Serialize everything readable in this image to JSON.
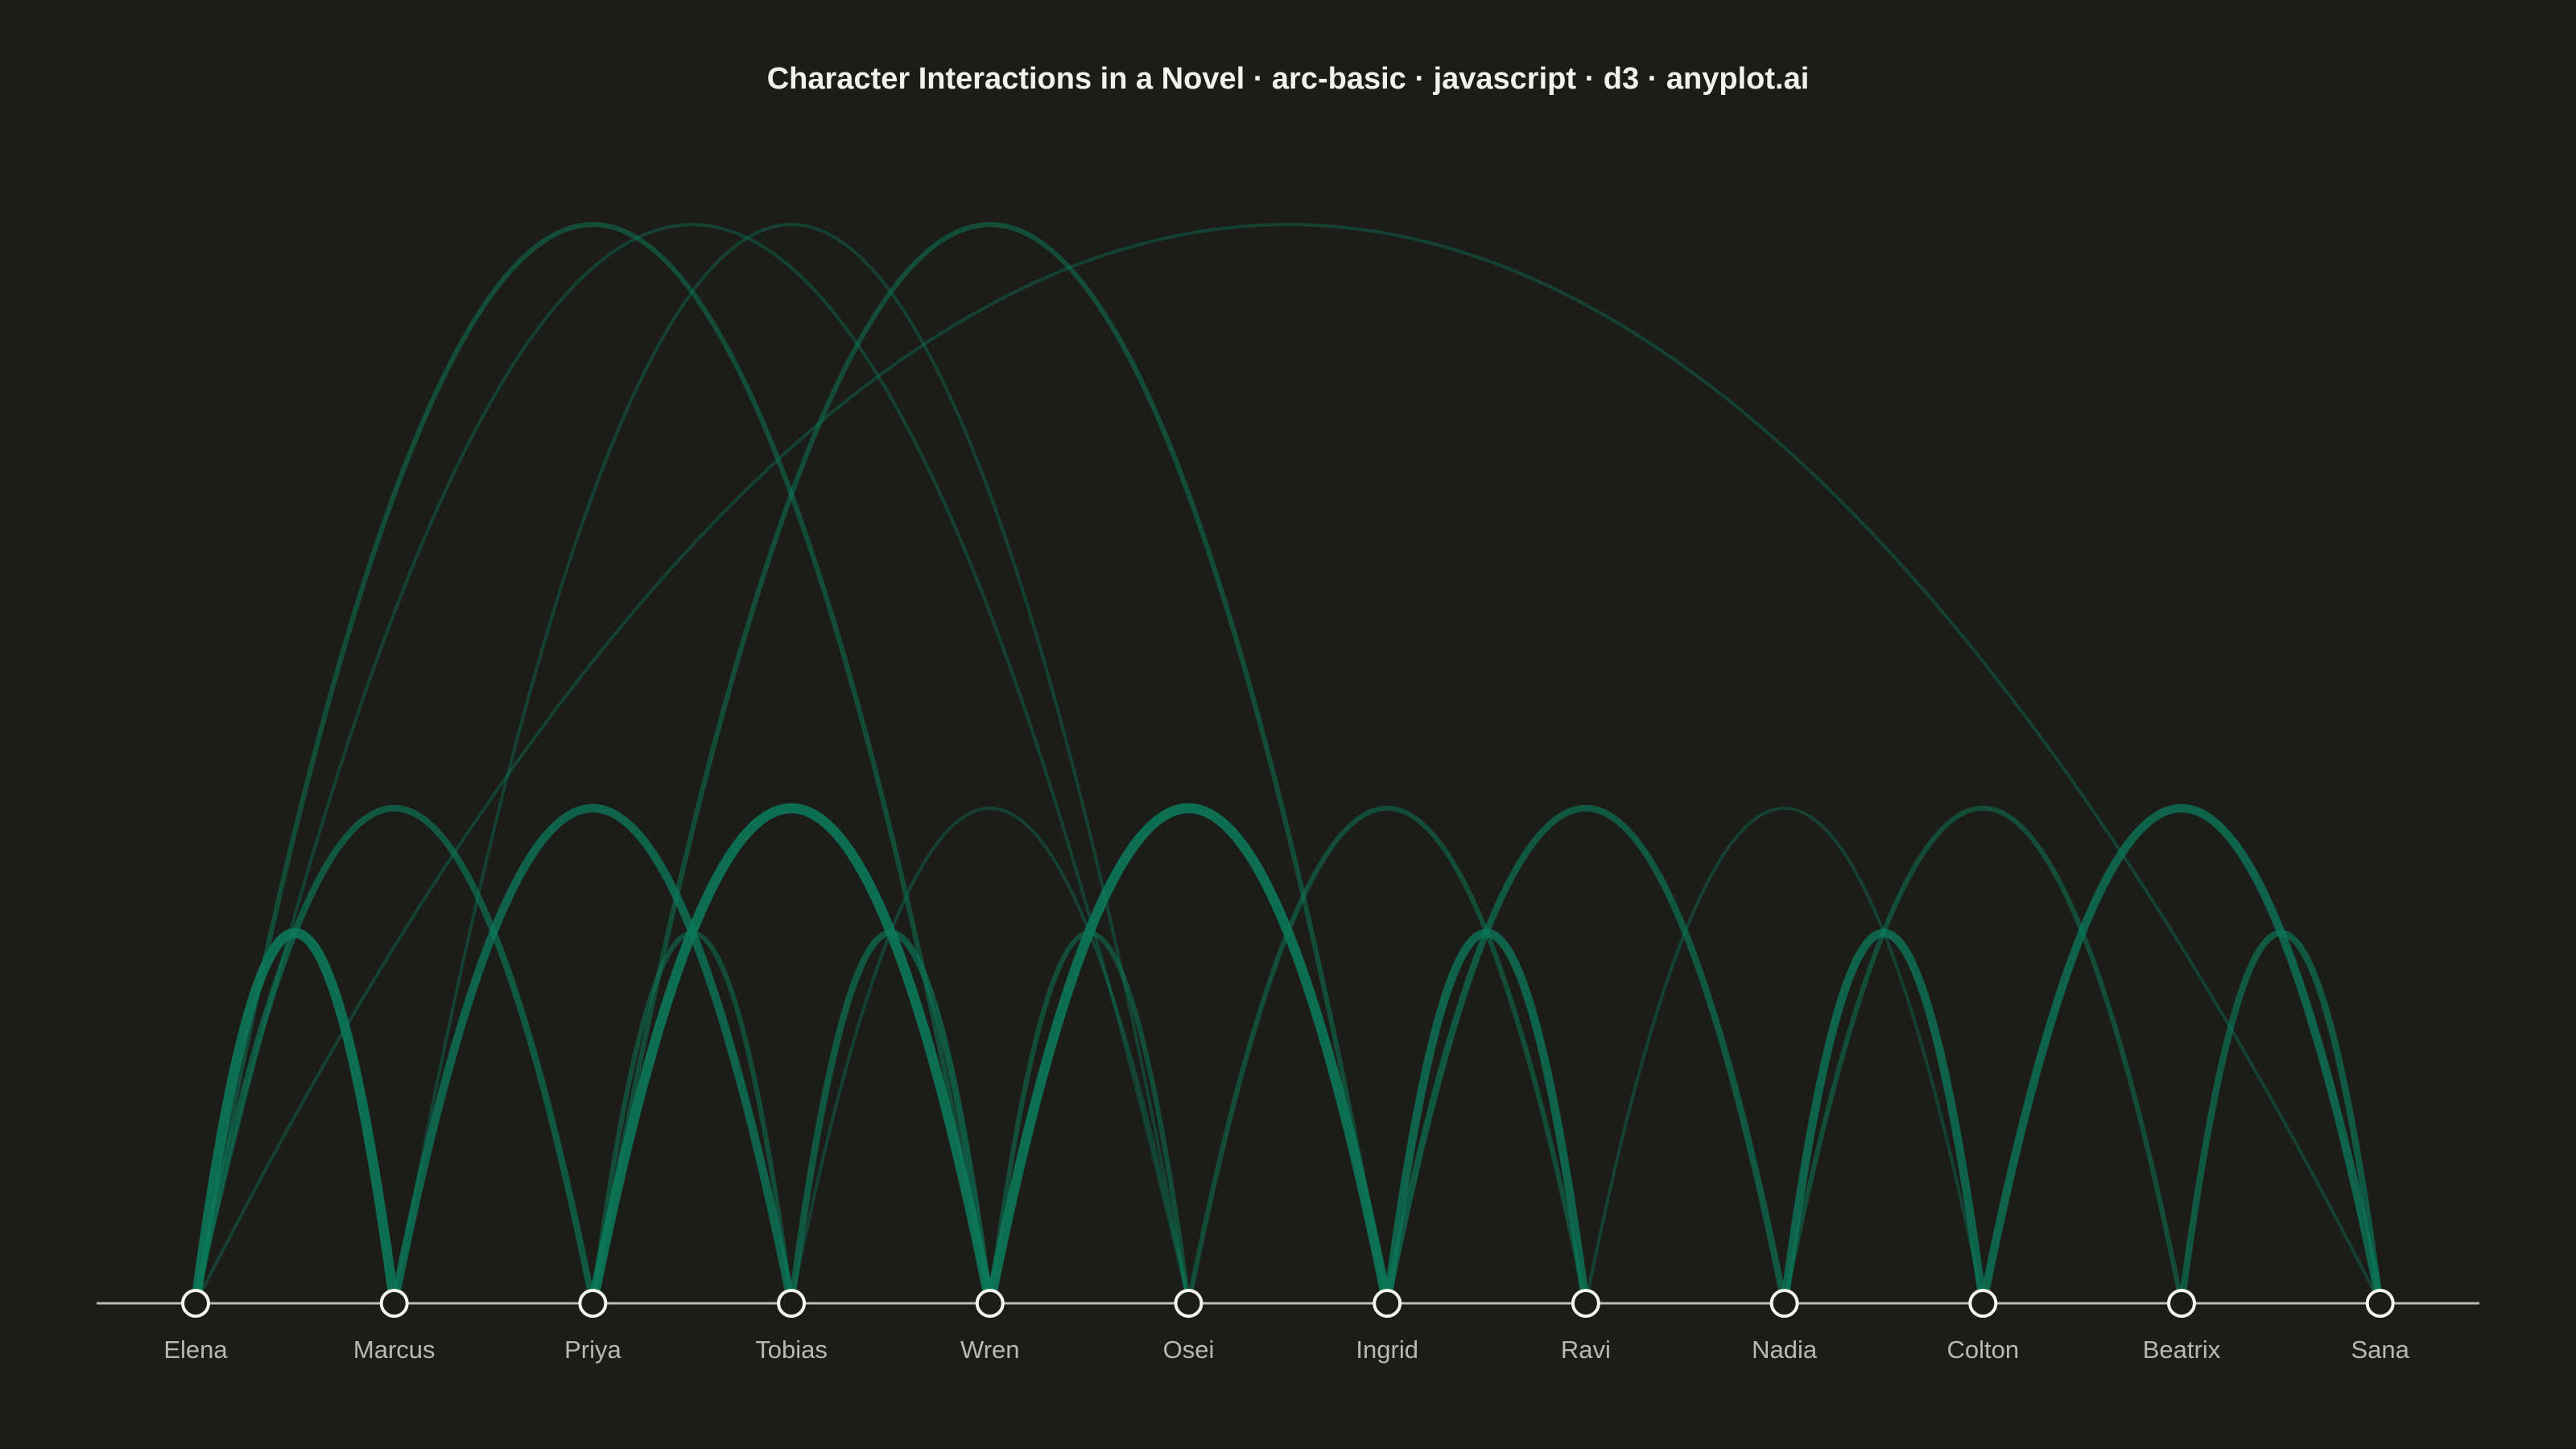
{
  "title": "Character Interactions in a Novel · arc-basic · javascript · d3 · anyplot.ai",
  "colors": {
    "background": "#1c1c19",
    "arc": "#0b7a59",
    "node_stroke": "#f5f5f2",
    "node_fill": "#1c1c19",
    "baseline": "#bdbcb6",
    "label": "#b9b8b2",
    "title": "#f2f1ec"
  },
  "chart_data": {
    "type": "arc-diagram",
    "nodes": [
      "Elena",
      "Marcus",
      "Priya",
      "Tobias",
      "Wren",
      "Osei",
      "Ingrid",
      "Ravi",
      "Nadia",
      "Colton",
      "Beatrix",
      "Sana"
    ],
    "edges": [
      {
        "source": "Elena",
        "target": "Marcus",
        "weight": 5
      },
      {
        "source": "Elena",
        "target": "Priya",
        "weight": 3
      },
      {
        "source": "Elena",
        "target": "Wren",
        "weight": 2
      },
      {
        "source": "Elena",
        "target": "Osei",
        "weight": 1
      },
      {
        "source": "Elena",
        "target": "Sana",
        "weight": 1
      },
      {
        "source": "Marcus",
        "target": "Tobias",
        "weight": 4
      },
      {
        "source": "Marcus",
        "target": "Osei",
        "weight": 1
      },
      {
        "source": "Priya",
        "target": "Tobias",
        "weight": 2
      },
      {
        "source": "Priya",
        "target": "Wren",
        "weight": 5
      },
      {
        "source": "Priya",
        "target": "Ingrid",
        "weight": 2
      },
      {
        "source": "Tobias",
        "target": "Wren",
        "weight": 3
      },
      {
        "source": "Tobias",
        "target": "Osei",
        "weight": 1
      },
      {
        "source": "Wren",
        "target": "Osei",
        "weight": 2
      },
      {
        "source": "Wren",
        "target": "Ingrid",
        "weight": 5
      },
      {
        "source": "Osei",
        "target": "Ravi",
        "weight": 2
      },
      {
        "source": "Ingrid",
        "target": "Ravi",
        "weight": 4
      },
      {
        "source": "Ingrid",
        "target": "Nadia",
        "weight": 3
      },
      {
        "source": "Ravi",
        "target": "Colton",
        "weight": 1
      },
      {
        "source": "Nadia",
        "target": "Colton",
        "weight": 4
      },
      {
        "source": "Nadia",
        "target": "Beatrix",
        "weight": 2
      },
      {
        "source": "Colton",
        "target": "Sana",
        "weight": 4
      },
      {
        "source": "Beatrix",
        "target": "Sana",
        "weight": 3
      }
    ]
  }
}
